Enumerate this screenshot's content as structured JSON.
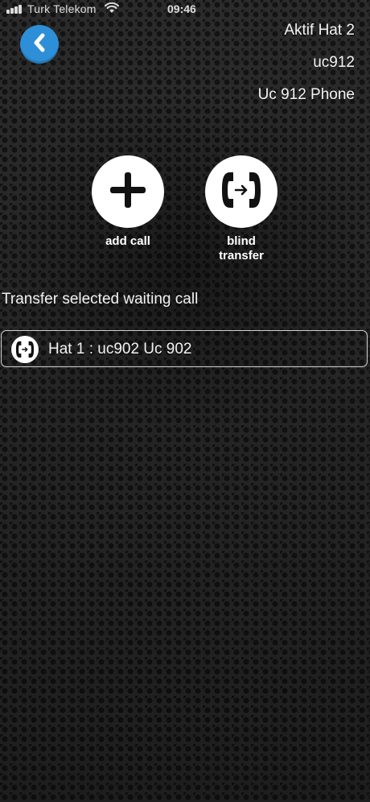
{
  "status_bar": {
    "carrier": "Turk Telekom",
    "time": "09:46"
  },
  "header": {
    "line_title": "Aktif Hat 2",
    "extension": "uc912",
    "device_name": "Uc 912 Phone"
  },
  "actions": {
    "add_call": "add call",
    "blind_transfer_line1": "blind",
    "blind_transfer_line2": "transfer"
  },
  "transfer": {
    "section_title": "Transfer selected waiting call",
    "waiting_calls": [
      {
        "label": "Hat 1 : uc902 Uc 902"
      }
    ]
  },
  "colors": {
    "accent": "#2d8fd8",
    "button_bg": "#ffffff",
    "text": "#ffffff"
  },
  "icons": {
    "back": "chevron-left-icon",
    "add": "plus-icon",
    "transfer": "phone-transfer-icon",
    "call_row": "phone-pair-icon"
  }
}
